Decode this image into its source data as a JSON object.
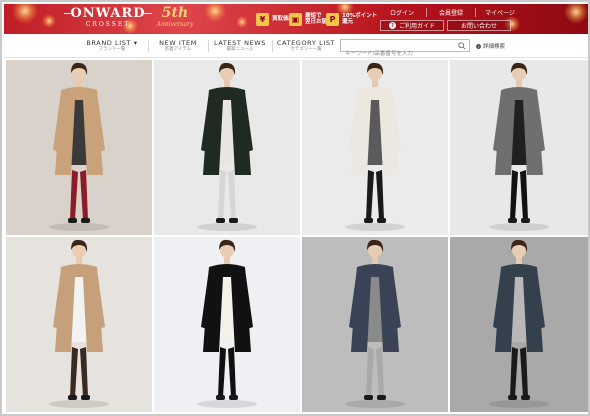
{
  "brand": {
    "logo": "ONWARD",
    "logo_sub": "CROSSET",
    "anniversary_num": "5th",
    "anniversary_txt": "Anniversary"
  },
  "promos": [
    {
      "icon": "¥",
      "line1": "買取価格",
      "line2": ""
    },
    {
      "icon": "▣",
      "line1": "最短で",
      "line2": "翌日お届け"
    },
    {
      "icon": "P",
      "line1": "10%ポイント",
      "line2": "還元"
    }
  ],
  "account_nav": {
    "login": "ログイン",
    "register": "会員登録",
    "mypage": "マイページ",
    "guide": "ご利用ガイド",
    "contact": "お問い合わせ"
  },
  "nav": {
    "items": [
      {
        "en": "BRAND LIST ▾",
        "jp": "ブランド一覧"
      },
      {
        "en": "NEW ITEM",
        "jp": "新着アイテム"
      },
      {
        "en": "LATEST NEWS",
        "jp": "最新ニュース"
      },
      {
        "en": "CATEGORY LIST",
        "jp": "カテゴリー一覧"
      }
    ],
    "search_placeholder": "キーワード/品番番号を入力",
    "detail_search": "詳細検索"
  },
  "colors": {
    "banner_red": "#b5121b",
    "accent_gold": "#f4d27a"
  },
  "looks": [
    {
      "coat": "#c9a27a",
      "inner": "#3a3a3a",
      "legs": "#8c1c2a",
      "bg": "#d8d2ca"
    },
    {
      "coat": "#1f2b22",
      "inner": "#e8e6e2",
      "legs": "#d6d6d6",
      "bg": "#e9e9e9"
    },
    {
      "coat": "#ece8e0",
      "inner": "#5a5a5a",
      "legs": "#1a1a1a",
      "bg": "#ebebeb"
    },
    {
      "coat": "#6f6f70",
      "inner": "#202020",
      "legs": "#111111",
      "bg": "#e8e8e8"
    },
    {
      "coat": "#c6a07b",
      "inner": "#f2f2f2",
      "legs": "#3a2a22",
      "bg": "#e6e3de"
    },
    {
      "coat": "#111111",
      "inner": "#f4f1ea",
      "legs": "#111111",
      "bg": "#eef0f3"
    },
    {
      "coat": "#3a4256",
      "inner": "#8a8a8a",
      "legs": "#a9a9a9",
      "bg": "#bdbdbd"
    },
    {
      "coat": "#34404c",
      "inner": "#b8b8b8",
      "legs": "#1a1a1a",
      "bg": "#a9a9a9"
    }
  ]
}
